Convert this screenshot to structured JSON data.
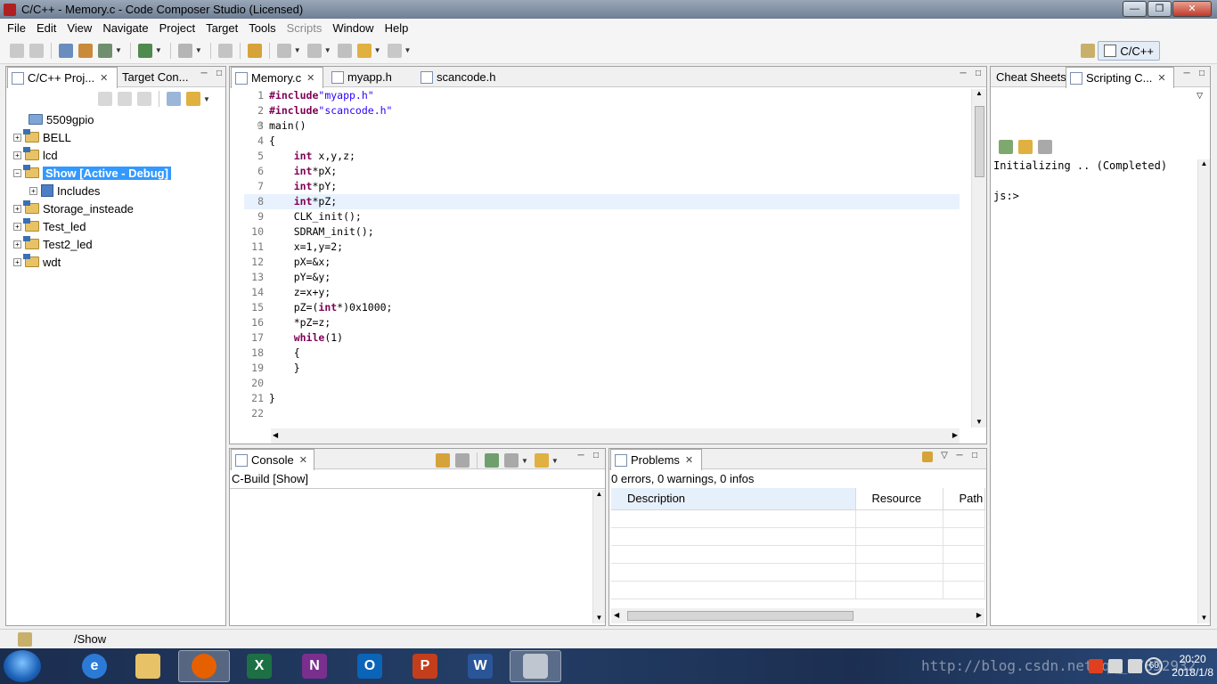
{
  "window": {
    "title": "C/C++ - Memory.c - Code Composer Studio (Licensed)"
  },
  "menu": [
    "File",
    "Edit",
    "View",
    "Navigate",
    "Project",
    "Target",
    "Tools",
    "Scripts",
    "Window",
    "Help"
  ],
  "perspective": {
    "label": "C/C++"
  },
  "left_panel": {
    "tabs": [
      {
        "label": "C/C++ Proj..."
      },
      {
        "label": "Target Con..."
      }
    ],
    "projects": [
      {
        "name": "5509gpio",
        "expandable": false
      },
      {
        "name": "BELL",
        "expandable": true
      },
      {
        "name": "lcd",
        "expandable": true
      },
      {
        "name": "Show  [Active - Debug]",
        "expandable": true,
        "expanded": true,
        "selected": true
      },
      {
        "name": "Includes",
        "child": true,
        "expandable": true
      },
      {
        "name": "Storage_insteade",
        "expandable": true
      },
      {
        "name": "Test_led",
        "expandable": true
      },
      {
        "name": "Test2_led",
        "expandable": true
      },
      {
        "name": "wdt",
        "expandable": true
      }
    ]
  },
  "editor": {
    "tabs": [
      {
        "label": "Memory.c"
      },
      {
        "label": "myapp.h"
      },
      {
        "label": "scancode.h"
      }
    ],
    "current_line": 8,
    "lines": [
      {
        "n": "1",
        "parts": [
          [
            "kw",
            "#include"
          ],
          [
            "str",
            "\"myapp.h\""
          ]
        ]
      },
      {
        "n": "2",
        "parts": [
          [
            "kw",
            "#include"
          ],
          [
            "str",
            "\"scancode.h\""
          ]
        ]
      },
      {
        "n": "3",
        "fold": true,
        "parts": [
          [
            "",
            "main()"
          ]
        ]
      },
      {
        "n": "4",
        "parts": [
          [
            "",
            "{"
          ]
        ]
      },
      {
        "n": "5",
        "parts": [
          [
            "",
            "    "
          ],
          [
            "kw",
            "int"
          ],
          [
            "",
            " x,y,z;"
          ]
        ]
      },
      {
        "n": "6",
        "parts": [
          [
            "",
            "    "
          ],
          [
            "kw",
            "int"
          ],
          [
            "",
            "*pX;"
          ]
        ]
      },
      {
        "n": "7",
        "parts": [
          [
            "",
            "    "
          ],
          [
            "kw",
            "int"
          ],
          [
            "",
            "*pY;"
          ]
        ]
      },
      {
        "n": "8",
        "parts": [
          [
            "",
            "    "
          ],
          [
            "kw",
            "int"
          ],
          [
            "",
            "*pZ;"
          ]
        ]
      },
      {
        "n": "9",
        "parts": [
          [
            "",
            "    CLK_init();"
          ]
        ]
      },
      {
        "n": "10",
        "parts": [
          [
            "",
            "    SDRAM_init();"
          ]
        ]
      },
      {
        "n": "11",
        "parts": [
          [
            "",
            "    x=1,y=2;"
          ]
        ]
      },
      {
        "n": "12",
        "parts": [
          [
            "",
            "    pX=&x;"
          ]
        ]
      },
      {
        "n": "13",
        "parts": [
          [
            "",
            "    pY=&y;"
          ]
        ]
      },
      {
        "n": "14",
        "parts": [
          [
            "",
            "    z=x+y;"
          ]
        ]
      },
      {
        "n": "15",
        "parts": [
          [
            "",
            "    pZ=("
          ],
          [
            "kw",
            "int"
          ],
          [
            "",
            "*)0x1000;"
          ]
        ]
      },
      {
        "n": "16",
        "parts": [
          [
            "",
            "    *pZ=z;"
          ]
        ]
      },
      {
        "n": "17",
        "parts": [
          [
            "",
            "    "
          ],
          [
            "kw",
            "while"
          ],
          [
            "",
            "(1)"
          ]
        ]
      },
      {
        "n": "18",
        "parts": [
          [
            "",
            "    {"
          ]
        ]
      },
      {
        "n": "19",
        "parts": [
          [
            "",
            "    }"
          ]
        ]
      },
      {
        "n": "20",
        "parts": [
          [
            "",
            ""
          ]
        ]
      },
      {
        "n": "21",
        "parts": [
          [
            "",
            "}"
          ]
        ]
      },
      {
        "n": "22",
        "parts": [
          [
            "",
            ""
          ]
        ]
      }
    ]
  },
  "right_panel": {
    "tabs": [
      {
        "label": "Cheat Sheets"
      },
      {
        "label": "Scripting C..."
      }
    ],
    "output_line1": "Initializing .. (Completed)",
    "output_line2": "js:>"
  },
  "console": {
    "tab": "Console",
    "header": "C-Build [Show]"
  },
  "problems": {
    "tab": "Problems",
    "summary": "0 errors, 0 warnings, 0 infos",
    "columns": [
      "Description",
      "Resource",
      "Path"
    ]
  },
  "statusbar": {
    "text": "/Show"
  },
  "taskbar": {
    "apps": [
      "Internet Explorer",
      "File Explorer",
      "Firefox",
      "Excel",
      "OneNote",
      "Outlook",
      "PowerPoint",
      "Word",
      "Code Composer Studio"
    ],
    "clock_time": "20:20",
    "clock_date": "2018/1/8",
    "tray_badge": "60"
  },
  "watermark": "http://blog.csdn.net/qq_37832932",
  "colors": {
    "keyword": "#7f0055",
    "string": "#2a00ff",
    "selection": "#3399ff",
    "current_line": "#e8f2fe"
  }
}
